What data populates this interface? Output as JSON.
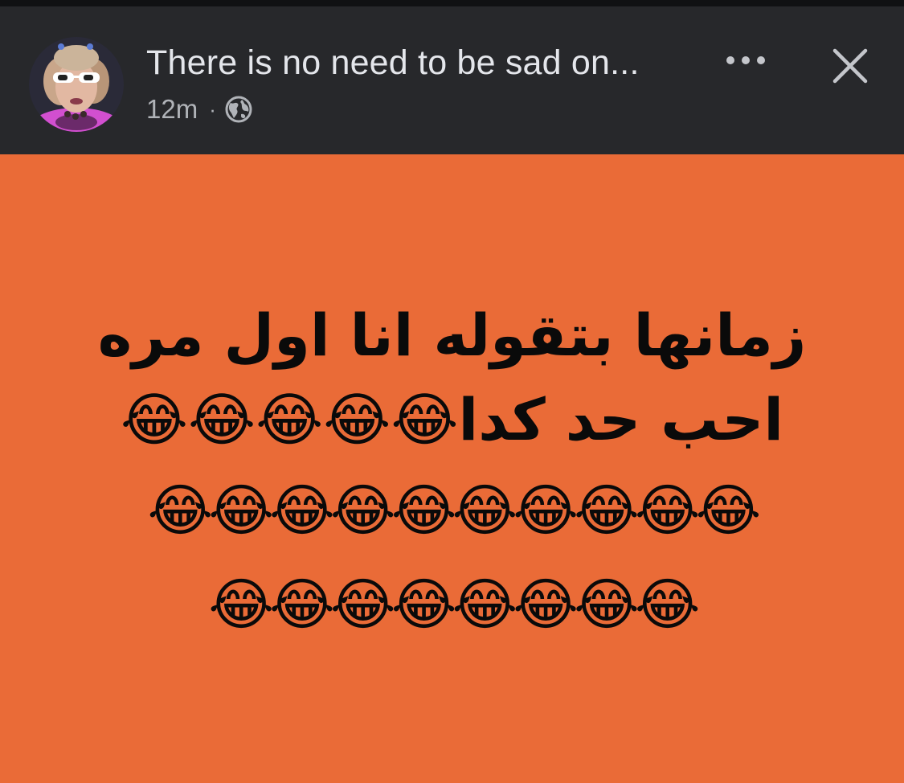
{
  "header": {
    "title": "There is no need to be sad on...",
    "timestamp": "12m",
    "separator": "·",
    "privacy_icon": "globe-icon",
    "more_icon": "more-horizontal-icon",
    "close_icon": "close-icon",
    "avatar": "profile-avatar"
  },
  "post": {
    "background_color": "#ea6b37",
    "line1": "زمانها بتقوله انا اول مره",
    "line2_text": "احب حد كدا",
    "line2_emojis": "😂😂😂😂😂",
    "line3_emojis": "😂😂😂😂😂😂😂😂😂😂",
    "line4_emojis": "😂😂😂😂😂😂😂😂"
  },
  "colors": {
    "header_bg": "#27282b",
    "title_text": "#e4e6eb",
    "meta_text": "#b0b3b8",
    "post_text": "#0a0a0a"
  }
}
